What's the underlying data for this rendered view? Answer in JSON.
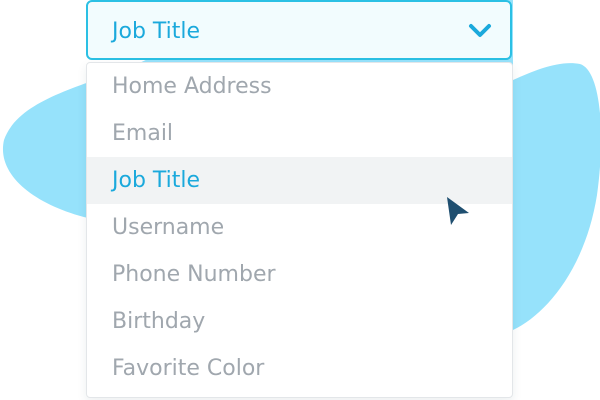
{
  "select": {
    "value": "Job Title",
    "icon": "chevron-down-icon"
  },
  "options": [
    {
      "label": "Home Address",
      "selected": false
    },
    {
      "label": "Email",
      "selected": false
    },
    {
      "label": "Job Title",
      "selected": true
    },
    {
      "label": "Username",
      "selected": false
    },
    {
      "label": "Phone Number",
      "selected": false
    },
    {
      "label": "Birthday",
      "selected": false
    },
    {
      "label": "Favorite Color",
      "selected": false
    }
  ],
  "colors": {
    "accent": "#1ba9dc",
    "border_accent": "#2bc0e4",
    "blob": "#96e2fb",
    "muted_text": "#a0a7ae",
    "highlight_bg": "#f1f3f4",
    "cursor": "#1f4f70"
  }
}
